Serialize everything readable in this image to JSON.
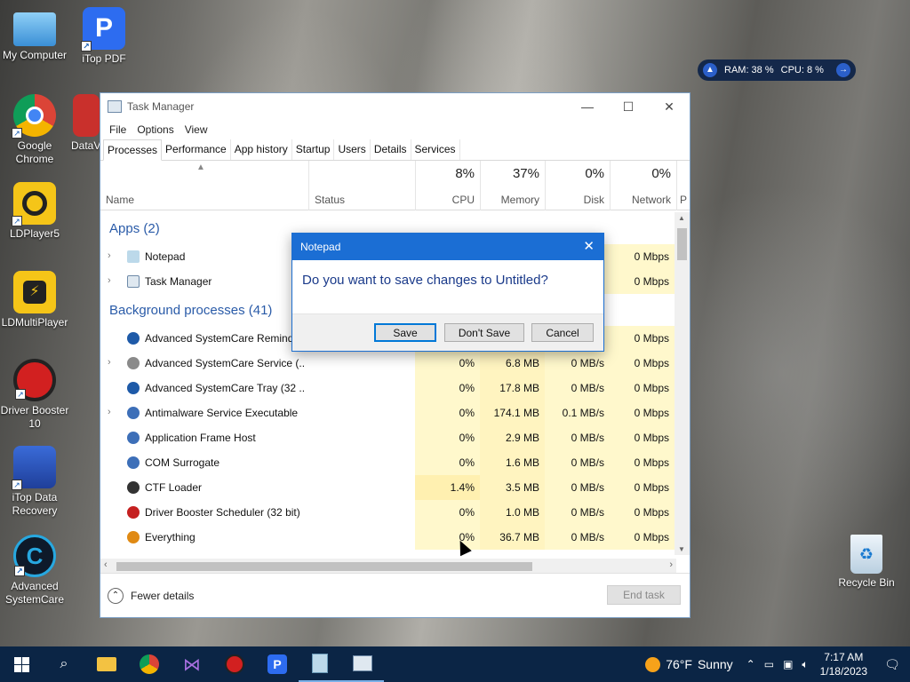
{
  "desktop": {
    "icons": [
      {
        "label": "My Computer",
        "icon": "computer-icon"
      },
      {
        "label": "iTop PDF",
        "icon": "pdf-icon"
      },
      {
        "label": "Google Chrome",
        "icon": "chrome-icon"
      },
      {
        "label": "DataV",
        "icon": "app-icon"
      },
      {
        "label": "LDPlayer5",
        "icon": "ldplayer-icon"
      },
      {
        "label": "LDMultiPlayer",
        "icon": "ldmultiplayer-icon"
      },
      {
        "label": "Driver Booster 10",
        "icon": "driver-booster-icon"
      },
      {
        "label": "iTop Data Recovery",
        "icon": "data-recovery-icon"
      },
      {
        "label": "Advanced SystemCare",
        "icon": "systemcare-icon"
      },
      {
        "label": "Recycle Bin",
        "icon": "recycle-bin-icon"
      }
    ],
    "widget": {
      "ram": "RAM: 38 %",
      "cpu": "CPU: 8 %"
    }
  },
  "task_manager": {
    "title": "Task Manager",
    "menu": [
      "File",
      "Options",
      "View"
    ],
    "tabs": [
      "Processes",
      "Performance",
      "App history",
      "Startup",
      "Users",
      "Details",
      "Services"
    ],
    "active_tab": "Processes",
    "columns": {
      "name": "Name",
      "status": "Status",
      "cpu": {
        "pct": "8%",
        "label": "CPU"
      },
      "memory": {
        "pct": "37%",
        "label": "Memory"
      },
      "disk": {
        "pct": "0%",
        "label": "Disk"
      },
      "network": {
        "pct": "0%",
        "label": "Network"
      },
      "power_partial": "P"
    },
    "apps_group": "Apps (2)",
    "apps": [
      {
        "name": "Notepad",
        "cpu": "",
        "mem": "",
        "disk": "",
        "net": "0 Mbps"
      },
      {
        "name": "Task Manager",
        "cpu": "",
        "mem": "",
        "disk": "",
        "net": "0 Mbps"
      }
    ],
    "bg_group": "Background processes (41)",
    "processes": [
      {
        "name": "Advanced SystemCare Reminder",
        "cpu": "",
        "mem": "",
        "disk": "",
        "net": "0 Mbps",
        "expand": false
      },
      {
        "name": "Advanced SystemCare Service (...",
        "cpu": "0%",
        "mem": "6.8 MB",
        "disk": "0 MB/s",
        "net": "0 Mbps",
        "expand": true
      },
      {
        "name": "Advanced SystemCare Tray (32 ...",
        "cpu": "0%",
        "mem": "17.8 MB",
        "disk": "0 MB/s",
        "net": "0 Mbps",
        "expand": false
      },
      {
        "name": "Antimalware Service Executable",
        "cpu": "0%",
        "mem": "174.1 MB",
        "disk": "0.1 MB/s",
        "net": "0 Mbps",
        "expand": true
      },
      {
        "name": "Application Frame Host",
        "cpu": "0%",
        "mem": "2.9 MB",
        "disk": "0 MB/s",
        "net": "0 Mbps",
        "expand": false
      },
      {
        "name": "COM Surrogate",
        "cpu": "0%",
        "mem": "1.6 MB",
        "disk": "0 MB/s",
        "net": "0 Mbps",
        "expand": false
      },
      {
        "name": "CTF Loader",
        "cpu": "1.4%",
        "mem": "3.5 MB",
        "disk": "0 MB/s",
        "net": "0 Mbps",
        "expand": false
      },
      {
        "name": "Driver Booster Scheduler (32 bit)",
        "cpu": "0%",
        "mem": "1.0 MB",
        "disk": "0 MB/s",
        "net": "0 Mbps",
        "expand": false
      },
      {
        "name": "Everything",
        "cpu": "0%",
        "mem": "36.7 MB",
        "disk": "0 MB/s",
        "net": "0 Mbps",
        "expand": false
      }
    ],
    "footer": {
      "fewer_details": "Fewer details",
      "end_task": "End task"
    }
  },
  "dialog": {
    "title": "Notepad",
    "message": "Do you want to save changes to Untitled?",
    "buttons": {
      "save": "Save",
      "dont_save": "Don't Save",
      "cancel": "Cancel"
    }
  },
  "taskbar": {
    "weather": {
      "temp": "76°F",
      "condition": "Sunny"
    },
    "time": "7:17 AM",
    "date": "1/18/2023"
  }
}
